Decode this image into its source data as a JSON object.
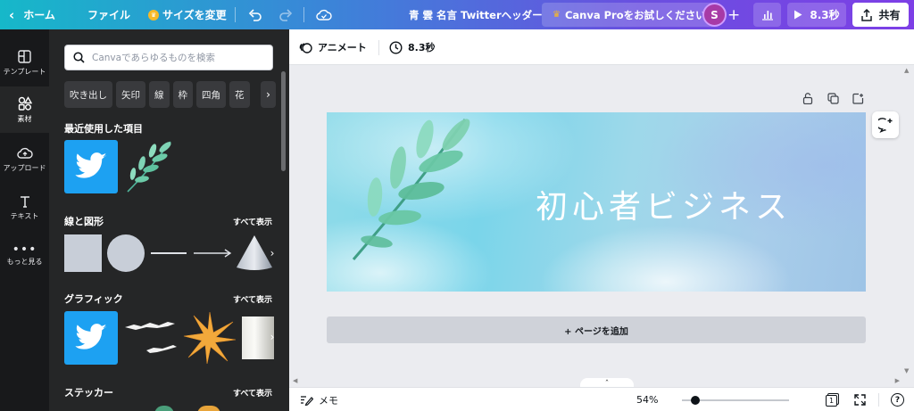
{
  "topbar": {
    "home": "ホーム",
    "file": "ファイル",
    "resize": "サイズを変更",
    "doc_title": "青 雲 名言 Twitterヘッダー",
    "pro": "Canva Proをお試しください",
    "avatar": "S",
    "play_time": "8.3秒",
    "share": "共有"
  },
  "rail": {
    "items": [
      "テンプレート",
      "素材",
      "アップロード",
      "テキスト",
      "もっと見る"
    ]
  },
  "panel": {
    "search_placeholder": "Canvaであらゆるものを検索",
    "chips": [
      "吹き出し",
      "矢印",
      "線",
      "枠",
      "四角",
      "花"
    ],
    "sections": {
      "recent": "最近使用した項目",
      "lines": "線と図形",
      "graphics": "グラフィック",
      "stickers": "ステッカー"
    },
    "see_all": "すべて表示"
  },
  "editor": {
    "animate": "アニメート",
    "duration": "8.3秒",
    "design_text": "初心者ビジネス",
    "add_page": "+ ページを追加"
  },
  "footer": {
    "notes": "メモ",
    "zoom": "54%",
    "zoom_fraction": 0.54,
    "page_count": "1",
    "help": "?"
  },
  "colors": {
    "accent_gradient_start": "#16b8c9",
    "accent_gradient_end": "#7d3fe6",
    "twitter_blue": "#1da1f2",
    "panel_bg": "#252627",
    "rail_bg": "#18191b"
  }
}
